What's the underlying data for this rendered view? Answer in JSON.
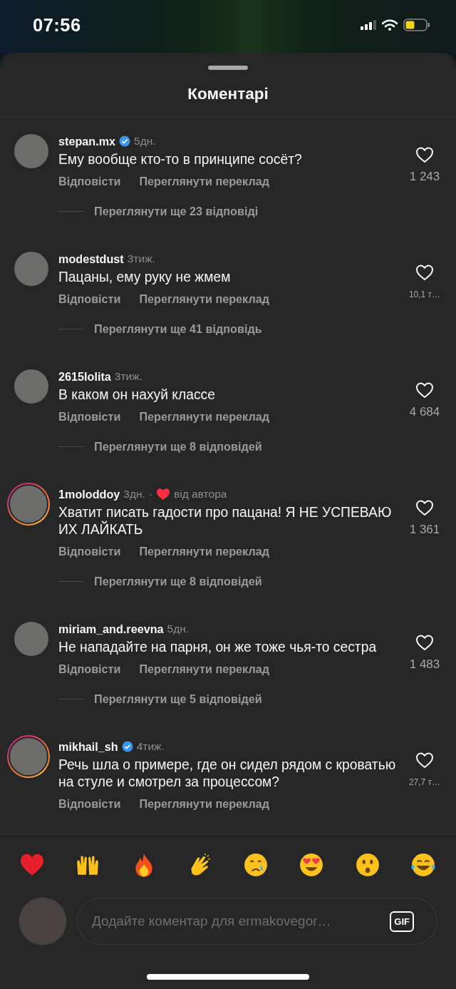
{
  "status_bar": {
    "time": "07:56"
  },
  "sheet": {
    "title": "Коментарі"
  },
  "comments": [
    {
      "username": "stepan.mx",
      "verified": true,
      "story_ring": false,
      "time": "5дн.",
      "text": "Ему вообще кто-то в принципе сосёт?",
      "reply": "Відповісти",
      "translate": "Переглянути переклад",
      "likes": "1 243",
      "more_replies": "Переглянути ще 23 відповіді"
    },
    {
      "username": "modestdust",
      "verified": false,
      "story_ring": false,
      "time": "3тиж.",
      "text": "Пацаны, ему руку не жмем",
      "reply": "Відповісти",
      "translate": "Переглянути переклад",
      "likes": "10,1 т…",
      "more_replies": "Переглянути ще 41 відповідь"
    },
    {
      "username": "2615lolita",
      "verified": false,
      "story_ring": false,
      "time": "3тиж.",
      "text": "В каком он нахуй классе",
      "reply": "Відповісти",
      "translate": "Переглянути переклад",
      "likes": "4 684",
      "more_replies": "Переглянути ще 8 відповідей"
    },
    {
      "username": "1moloddoy",
      "verified": false,
      "story_ring": true,
      "time": "3дн.",
      "author_like": {
        "separator": "·",
        "label": "від автора"
      },
      "text": "Хватит писать гадости про пацана! Я НЕ УСПЕВАЮ ИХ ЛАЙКАТЬ",
      "reply": "Відповісти",
      "translate": "Переглянути переклад",
      "likes": "1 361",
      "more_replies": "Переглянути ще 8 відповідей"
    },
    {
      "username": "miriam_and.reevna",
      "verified": false,
      "story_ring": false,
      "time": "5дн.",
      "text": "Не нападайте на парня, он же тоже чья-то сестра",
      "reply": "Відповісти",
      "translate": "Переглянути переклад",
      "likes": "1 483",
      "more_replies": "Переглянути ще 5 відповідей"
    },
    {
      "username": "mikhail_sh",
      "verified": true,
      "story_ring": true,
      "time": "4тиж.",
      "text": "Речь шла о примере, где он сидел рядом с кроватью на стуле и смотрел за процессом?",
      "reply": "Відповісти",
      "translate": "Переглянути переклад",
      "likes": "27,7 т…"
    }
  ],
  "reactions": [
    {
      "kind": "heart"
    },
    {
      "kind": "raised-hands"
    },
    {
      "kind": "fire"
    },
    {
      "kind": "clap"
    },
    {
      "kind": "crying"
    },
    {
      "kind": "heart-eyes"
    },
    {
      "kind": "surprised"
    },
    {
      "kind": "tears-of-joy"
    }
  ],
  "composer": {
    "placeholder": "Додайте коментар для ermakovegor…",
    "gif_label": "GIF"
  }
}
